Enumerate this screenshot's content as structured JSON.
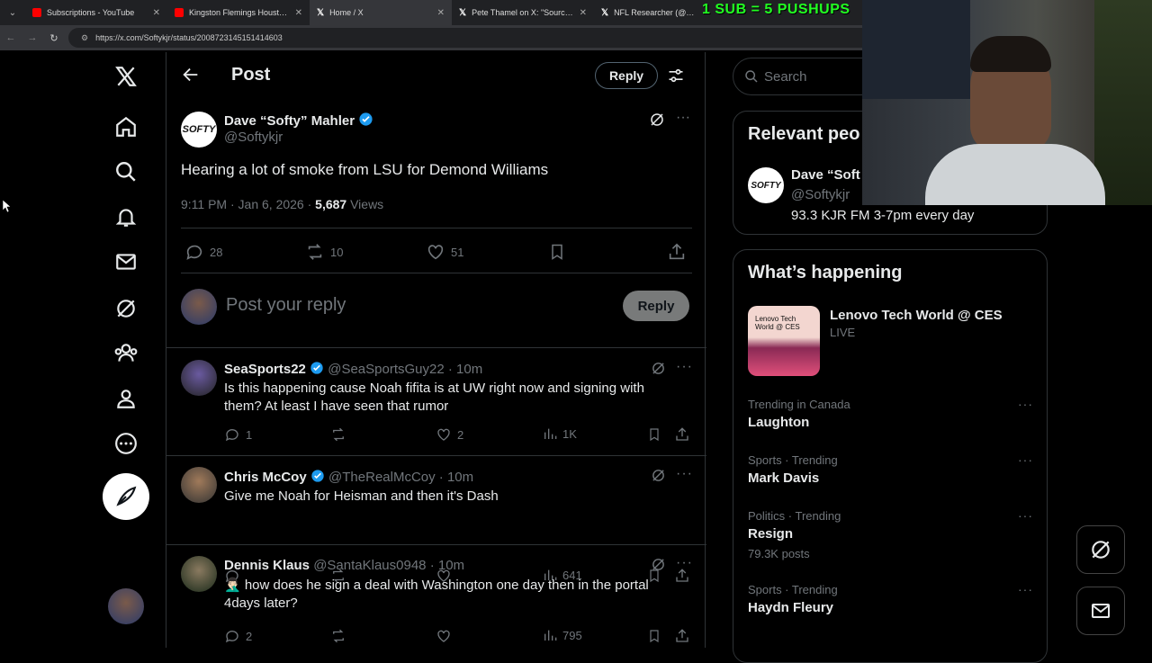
{
  "browser": {
    "tabs": [
      {
        "title": "Subscriptions - YouTube",
        "favicon_color": "#ff0000"
      },
      {
        "title": "Kingston Flemings Houston Ma",
        "favicon_color": "#ff0000"
      },
      {
        "title": "Home / X",
        "favicon_color": "#ffffff"
      },
      {
        "title": "Pete Thamel on X: \"Sources: Ol",
        "favicon_color": "#ffffff"
      },
      {
        "title": "NFL Researcher (@NFL_Rese",
        "favicon_color": "#ffffff"
      }
    ],
    "url": "https://x.com/Softykjr/status/2008723145151414603",
    "overlay": "1 SUB = 5 PUSHUPS"
  },
  "header": {
    "title": "Post",
    "reply_label": "Reply"
  },
  "tweet": {
    "name": "Dave “Softy” Mahler",
    "handle": "@Softykjr",
    "avatar_text": "SOFTY",
    "text": "Hearing a lot of smoke from LSU for Demond Williams",
    "time": "9:11 PM · Jan 6, 2026 · ",
    "views_count": "5,687",
    "views_label": " Views",
    "replies": "28",
    "reposts": "10",
    "likes": "51"
  },
  "composer": {
    "placeholder": "Post your reply",
    "button": "Reply"
  },
  "comments": [
    {
      "name": "SeaSports22",
      "handle": "@SeaSportsGuy22 · 10m",
      "text": "Is this happening cause Noah fifita is at UW right now and signing with them? At least I have seen that rumor",
      "replies": "1",
      "reposts": "",
      "likes": "2",
      "views": "1K"
    },
    {
      "name": "Chris McCoy",
      "handle": "@TheRealMcCoy · 10m",
      "text": "Give me Noah for Heisman and then it's Dash",
      "replies": "",
      "reposts": "",
      "likes": "",
      "views": "641"
    },
    {
      "name": "Dennis Klaus",
      "handle": "@SantaKlaus0948 · 10m",
      "text": "🤦🏻‍♂️ how does he sign a deal with Washington one day then in the portal 4days later?",
      "replies": "2",
      "reposts": "",
      "likes": "",
      "views": "795"
    }
  ],
  "sidebar": {
    "search_placeholder": "Search",
    "relevant_title": "Relevant peo",
    "relevant_name": "Dave “Soft",
    "relevant_handle": "@Softykjr",
    "relevant_bio": "93.3 KJR FM 3-7pm every day",
    "happening_title": "What’s happening",
    "event_title": "Lenovo Tech World @ CES",
    "event_status": "LIVE",
    "event_thumb_text": "Lenovo Tech World @ CES",
    "trends": [
      {
        "category": "Trending in Canada",
        "name": "Laughton",
        "posts": ""
      },
      {
        "category": "Sports · Trending",
        "name": "Mark Davis",
        "posts": ""
      },
      {
        "category": "Politics · Trending",
        "name": "Resign",
        "posts": "79.3K posts"
      },
      {
        "category": "Sports · Trending",
        "name": "Haydn Fleury",
        "posts": ""
      }
    ]
  },
  "colors": {
    "background": "#000000",
    "text": "#e7e9ea",
    "muted": "#71767b",
    "border": "#2f3336",
    "verified": "#1d9bf0",
    "overlay": "#22ff22"
  }
}
